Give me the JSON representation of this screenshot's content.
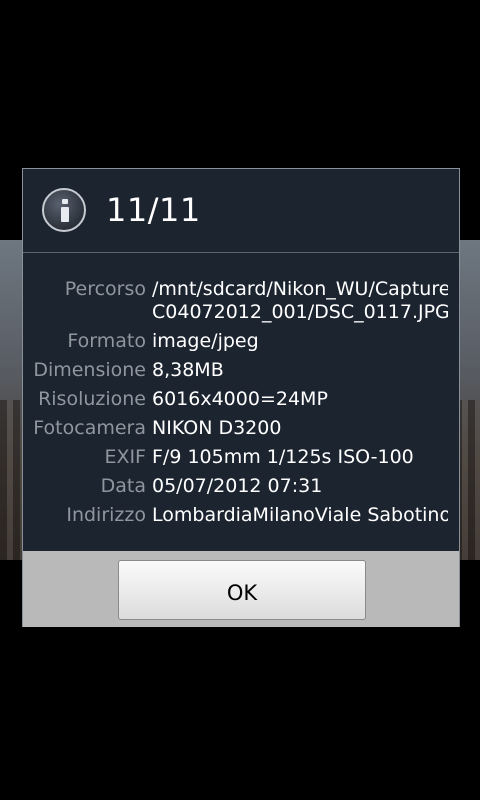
{
  "dialog": {
    "title": "11/11",
    "icon": "info-icon",
    "details": [
      {
        "label": "Percorso",
        "value_lines": [
          "/mnt/sdcard/Nikon_WU/Capture",
          "C04072012_001/DSC_0117.JPG"
        ]
      },
      {
        "label": "Formato",
        "value": "image/jpeg"
      },
      {
        "label": "Dimensione",
        "value": "8,38MB"
      },
      {
        "label": "Risoluzione",
        "value": "6016x4000=24MP"
      },
      {
        "label": "Fotocamera",
        "value": "NIKON D3200"
      },
      {
        "label": "EXIF",
        "value": "F/9 105mm 1/125s ISO-100"
      },
      {
        "label": "Data",
        "value": "05/07/2012 07:31"
      },
      {
        "label": "Indirizzo",
        "value": "LombardiaMilanoViale Sabotino"
      }
    ],
    "ok_label": "OK"
  },
  "colors": {
    "dialog_background": "#1c2430",
    "label_text": "#8f969e",
    "value_text": "#ffffff",
    "footer_background": "#b9b9b9"
  }
}
